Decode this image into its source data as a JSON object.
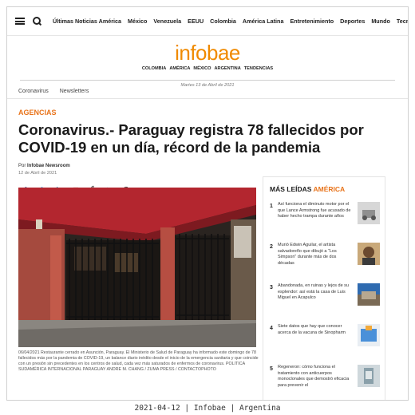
{
  "nav": {
    "items": [
      "Últimas Noticias América",
      "México",
      "Venezuela",
      "EEUU",
      "Colombia",
      "América Latina",
      "Entretenimiento",
      "Deportes",
      "Mundo",
      "Tecno"
    ]
  },
  "header": {
    "logo": "infobae",
    "editions": [
      "COLOMBIA",
      "AMÉRICA",
      "MÉXICO",
      "ARGENTINA",
      "TENDENCIAS"
    ],
    "date": "Martes 13 de Abril de 2021"
  },
  "subnav": [
    "Coronavirus",
    "Newsletters"
  ],
  "article": {
    "section": "AGENCIAS",
    "headline": "Coronavirus.- Paraguay registra 78 fallecidos por COVID-19 en un día, récord de la pandemia",
    "byline_prefix": "Por",
    "author": "Infobae Newsroom",
    "date": "12 de Abril de 2021",
    "caption": "06/04/2021 Restaurante cerrado en Asunción, Paraguay. El Ministerio de Salud de Paraguay ha informado este domingo de 78 fallecidos más por la pandemia de COVID-19, un balance diario inédito desde el inicio de la emergencia sanitaria y que coincide con un presión sin precedentes en los centros de salud, cada vez más saturados de enfermos de coronavirus. POLITICA SUDAMÉRICA INTERNACIONAL PARAGUAY ANDRE M. CHANG / ZUMA PRESS / CONTACTOPHOTO"
  },
  "share": {
    "icons": [
      "facebook-icon",
      "twitter-icon",
      "linkedin-icon",
      "email-icon",
      "print-icon",
      "telegram-icon",
      "whatsapp-icon"
    ],
    "glyphs": [
      "f",
      "𝕥",
      "in",
      "✉",
      "⎙",
      "➤",
      "✆"
    ],
    "colors": [
      "#3b5998",
      "#1da1f2",
      "#0077b5",
      "#d44638",
      "#555555",
      "#2ca5e0",
      "#222222"
    ]
  },
  "sidebar": {
    "title_part1": "MÁS LEÍDAS",
    "title_part2": "AMÉRICA",
    "items": [
      {
        "num": "1",
        "text": "Así funciona el diminuto motor por el que Lance Armstrong fue acusado de haber hecho trampa durante años"
      },
      {
        "num": "2",
        "text": "Murió Edwin Aguilar, el artista salvadoreño que dibujó a “Los Simpson” durante más de dos décadas"
      },
      {
        "num": "3",
        "text": "Abandonada, en ruinas y lejos de su esplendor: así está la casa de Luis Miguel en Acapulco"
      },
      {
        "num": "4",
        "text": "Siete datos que hay que conocer acerca de la vacuna de Sinopharm"
      },
      {
        "num": "5",
        "text": "Regeneron: cómo funciona el tratamiento con anticuerpos monoclonales que demostró eficacia para prevenir el"
      }
    ]
  },
  "footer": "2021-04-12 | Infobae | Argentina",
  "colors": {
    "accent": "#e8731a",
    "logo": "#f08a00"
  }
}
